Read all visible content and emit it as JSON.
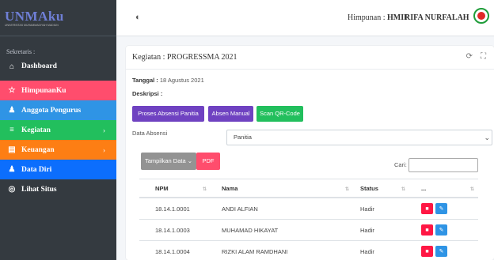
{
  "brand": {
    "logo": "UNMAku",
    "logo_sub": "UNIVERSITAS MUHAMMADIYAH MADIUN"
  },
  "sidebar": {
    "section_label": "Sekretaris :",
    "items": [
      {
        "label": "Dashboard",
        "icon": "home-icon"
      },
      {
        "label": "HimpunanKu",
        "icon": "star-icon"
      },
      {
        "label": "Anggota Pengurus",
        "icon": "users-icon"
      },
      {
        "label": "Kegiatan",
        "icon": "layers-icon"
      },
      {
        "label": "Keuangan",
        "icon": "wallet-icon"
      },
      {
        "label": "Data Diri",
        "icon": "user-icon"
      },
      {
        "label": "Lihat Situs",
        "icon": "globe-icon"
      }
    ]
  },
  "topbar": {
    "himpunan_label": "Himpunan : ",
    "himpunan_value": "HMIF",
    "user_name": "RIFA NURFALAH"
  },
  "card": {
    "title": "Kegiatan : PROGRESSMA 2021",
    "tanggal_label": "Tanggal :",
    "tanggal_value": " 18 Agustus 2021",
    "deskripsi_label": "Deskripsi :",
    "buttons": {
      "proses": "Proses Absensi Panitia",
      "manual": "Absen Manual",
      "scan": "Scan QR-Code"
    },
    "absensi_label": "Data Absensi",
    "absensi_selected": "Panitia",
    "tampilkan": "Tampilkan Data",
    "pdf": "PDF",
    "cari_label": "Cari:"
  },
  "table": {
    "headers": [
      "NPM",
      "Nama",
      "Status",
      "..."
    ],
    "rows": [
      {
        "npm": "18.14.1.0001",
        "nama": "ANDI ALFIAN",
        "status": "Hadir"
      },
      {
        "npm": "18.14.1.0003",
        "nama": "MUHAMAD HIKAYAT",
        "status": "Hadir"
      },
      {
        "npm": "18.14.1.0004",
        "nama": "RIZKI ALAM RAMDHANI",
        "status": "Hadir"
      }
    ]
  },
  "colors": {
    "sidebar_bg": "#343a40",
    "himpunan": "#ff4d6d",
    "anggota": "#2f94e5",
    "kegiatan": "#22bf5d",
    "keuangan": "#fd7e14",
    "datadiri": "#0c6efd",
    "purple_button": "#6f42c1"
  }
}
